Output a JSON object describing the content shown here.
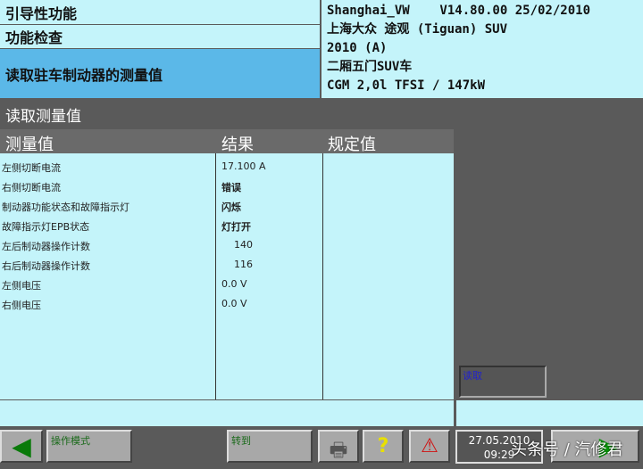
{
  "nav": {
    "level1": "引导性功能",
    "level2": "功能检查",
    "level3": "读取驻车制动器的测量值"
  },
  "vehicle": {
    "line1": "Shanghai_VW    V14.80.00 25/02/2010",
    "line2": "上海大众 途观 (Tiguan) SUV",
    "line3": "2010 (A)",
    "line4": "二厢五门SUV车",
    "line5": "CGM 2,0l TFSI / 147kW"
  },
  "section_title": "读取测量值",
  "table": {
    "headers": [
      "测量值",
      "结果",
      "规定值"
    ],
    "rows": [
      {
        "name": "左侧切断电流",
        "result": "17.100 A",
        "spec": ""
      },
      {
        "name": "右侧切断电流",
        "result": "错误",
        "spec": ""
      },
      {
        "name": "制动器功能状态和故障指示灯",
        "result": "闪烁",
        "spec": ""
      },
      {
        "name": "故障指示灯EPB状态",
        "result": "灯打开",
        "spec": ""
      },
      {
        "name": "左后制动器操作计数",
        "result": "140",
        "spec": ""
      },
      {
        "name": "右后制动器操作计数",
        "result": "116",
        "spec": ""
      },
      {
        "name": "左侧电压",
        "result": "0.0 V",
        "spec": ""
      },
      {
        "name": "右侧电压",
        "result": "0.0 V",
        "spec": ""
      }
    ]
  },
  "read_button": "读取",
  "toolbar": {
    "mode": "操作模式",
    "goto": "转到",
    "date": "27.05.2010",
    "time": "09:29"
  },
  "watermark": "头条号 / 汽修君"
}
